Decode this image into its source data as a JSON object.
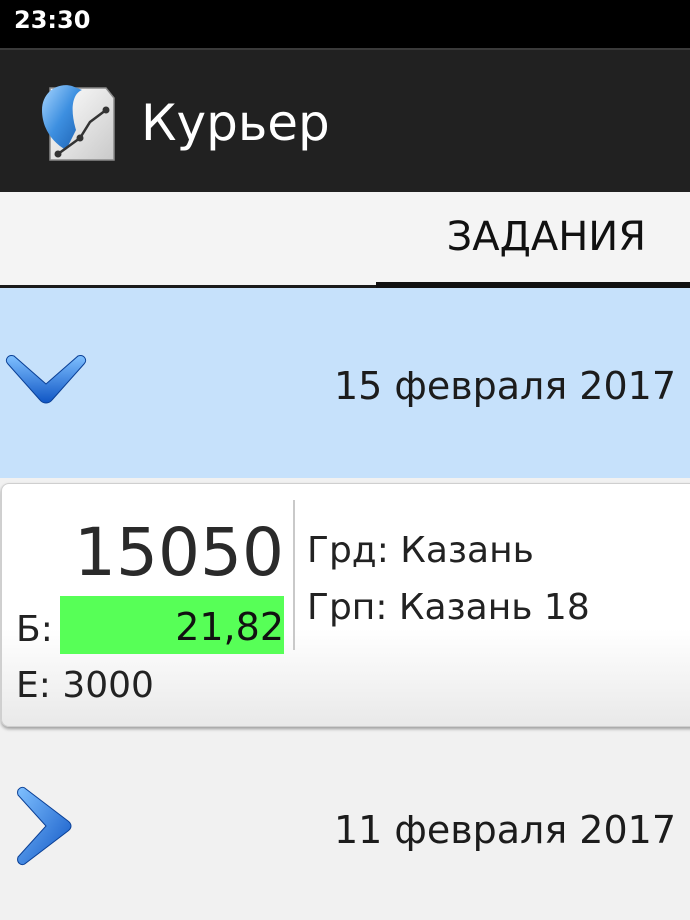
{
  "status_bar": {
    "time": "23:30"
  },
  "action_bar": {
    "title": "Курьер",
    "icon": "courier-app-icon"
  },
  "tabs": [
    {
      "label": "ЗАДАНИЯ",
      "selected": true
    }
  ],
  "groups": [
    {
      "date": "15 февраля 2017",
      "expanded": true,
      "icon": "chevron-down-icon"
    },
    {
      "date": "11 февраля 2017",
      "expanded": false,
      "icon": "chevron-right-icon"
    }
  ],
  "task": {
    "number": "15050",
    "balance_label": "Б:",
    "balance_value": "21,82",
    "e_text": "Е: 3000",
    "city": "Грд: Казань",
    "group": "Грп: Казань 18"
  },
  "colors": {
    "status_bar": "#000000",
    "action_bar": "#212121",
    "selected_group": "#c6e1fb",
    "balance_highlight": "#57ff57",
    "chevron": "#1e6fd9"
  }
}
